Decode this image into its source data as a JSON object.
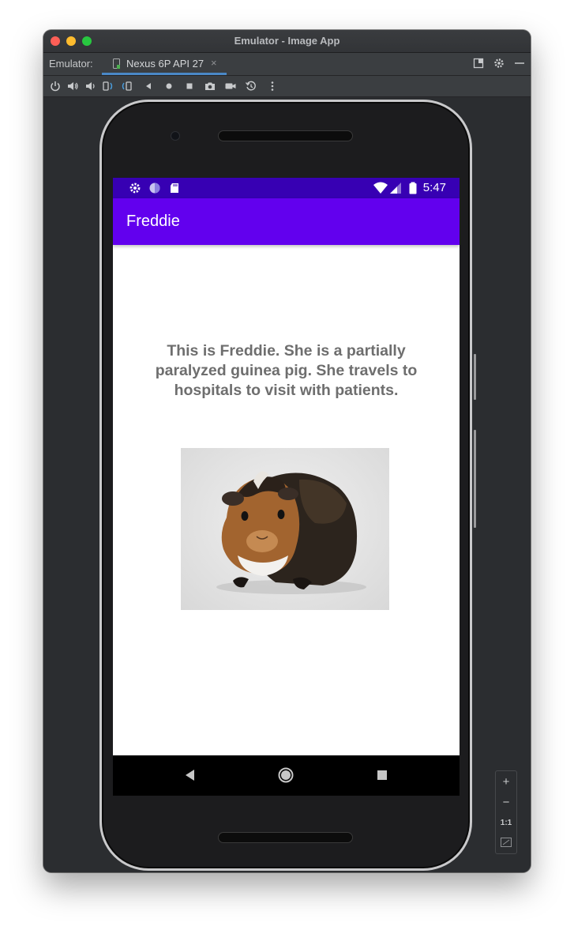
{
  "window": {
    "title": "Emulator - Image App"
  },
  "tabbar": {
    "label": "Emulator:",
    "tab": {
      "label": "Nexus 6P API 27",
      "close": "×"
    }
  },
  "toolbar": {
    "buttons": [
      "power-icon",
      "volume-up-icon",
      "volume-down-icon",
      "rotate-left-icon",
      "rotate-right-icon",
      "back-icon",
      "home-icon",
      "overview-icon",
      "screenshot-icon",
      "screen-record-icon",
      "snapshot-icon",
      "more-icon"
    ]
  },
  "device": {
    "status_bar": {
      "time": "5:47"
    },
    "app_bar": {
      "title": "Freddie"
    },
    "body_text": "This is Freddie. She is a partially paralyzed guinea pig. She travels to hospitals to visit with patients.",
    "photo": {
      "subject": "guinea-pig-photo"
    }
  },
  "zoom_panel": {
    "zoom_in": "+",
    "zoom_out": "−",
    "actual_size": "1:1"
  },
  "colors": {
    "status_bar": "#3700b3",
    "app_bar": "#6200ee",
    "ide_background": "#2b2d30",
    "body_text": "#6e6e6e"
  }
}
